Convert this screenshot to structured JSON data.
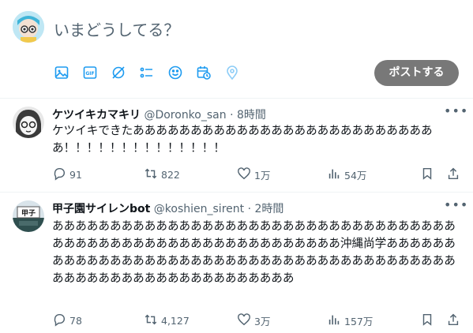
{
  "composer": {
    "placeholder": "いまどうしてる？",
    "post_label": "ポストする",
    "tools": [
      "image-icon",
      "gif-icon",
      "grok-icon",
      "list-icon",
      "emoji-icon",
      "schedule-icon",
      "location-icon"
    ]
  },
  "tweets": [
    {
      "name": "ケツイキカマキリ",
      "handle": "@Doronko_san",
      "dot": "·",
      "time": "8時間",
      "text": "ケツイキできたあああああああああああああああああああああああああああ！！！！！！！！！！！！！！",
      "replies": "91",
      "retweets": "822",
      "likes": "1万",
      "views": "54万"
    },
    {
      "name": "甲子園サイレンbot",
      "handle": "@koshien_sirent",
      "dot": "·",
      "time": "2時間",
      "text": "ああああああああああああああああああああああああああああああああああああああああああああああああああああああああああああ沖縄尚学ああああああああああああああああああああああああああああああああああああああああああああああああああああああああああああああ",
      "replies": "78",
      "retweets": "4,127",
      "likes": "3万",
      "views": "157万"
    }
  ],
  "colors": {
    "post_button": "#787878",
    "accent": "#1d9bf0",
    "muted": "#536471"
  }
}
